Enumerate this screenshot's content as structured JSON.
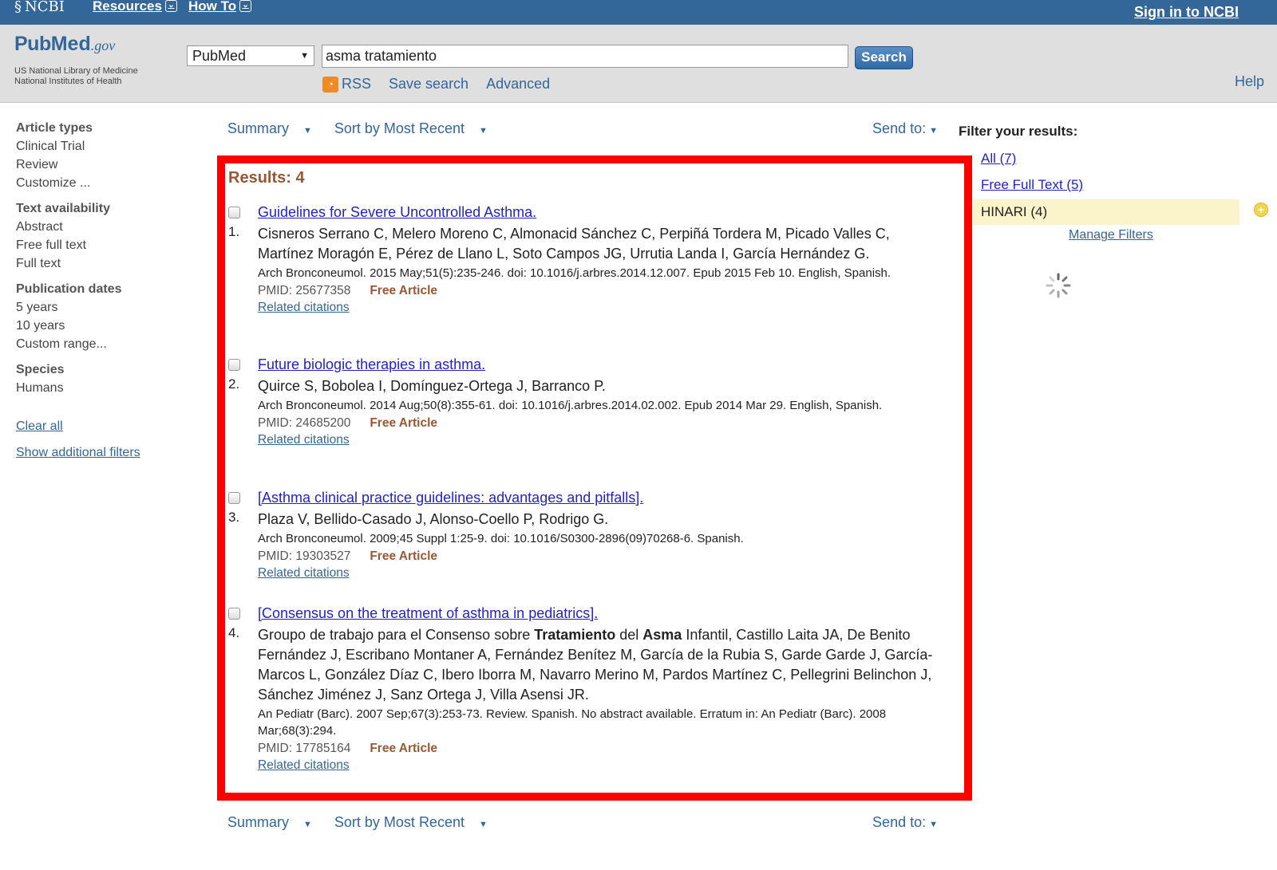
{
  "ncbi": {
    "logo": "NCBI",
    "menu": [
      "Resources",
      "How To"
    ],
    "sign_in": "Sign in to NCBI"
  },
  "header": {
    "logo_pub": "Pub",
    "logo_med": "Med",
    "logo_gov": ".gov",
    "subtitle_1": "US National Library of Medicine",
    "subtitle_2": "National Institutes of Health",
    "database": "PubMed",
    "query": "asma tratamiento",
    "search_label": "Search",
    "rss": "RSS",
    "save_search": "Save search",
    "advanced": "Advanced",
    "help": "Help"
  },
  "sidebar": {
    "groups": [
      {
        "title": "Article types",
        "items": [
          "Clinical Trial",
          "Review",
          "Customize ..."
        ]
      },
      {
        "title": "Text availability",
        "items": [
          "Abstract",
          "Free full text",
          "Full text"
        ]
      },
      {
        "title": "Publication dates",
        "items": [
          "5 years",
          "10 years",
          "Custom range..."
        ]
      },
      {
        "title": "Species",
        "items": [
          "Humans"
        ]
      }
    ],
    "clear_all": "Clear all",
    "show_filters": "Show additional filters"
  },
  "toolbar": {
    "summary": "Summary",
    "sort": "Sort by Most Recent",
    "send_to": "Send to:"
  },
  "results": {
    "count_label": "Results: 4",
    "items": [
      {
        "num": "1.",
        "title": "Guidelines for Severe Uncontrolled Asthma.",
        "authors": "Cisneros Serrano C, Melero Moreno C, Almonacid Sánchez C, Perpiñá Tordera M, Picado Valles C, Martínez Moragón E, Pérez de Llano L, Soto Campos JG, Urrutia Landa I, García Hernández G.",
        "journal": "Arch Bronconeumol. 2015 May;51(5):235-246. doi: 10.1016/j.arbres.2014.12.007. Epub 2015 Feb 10. English, Spanish.",
        "pmid": "PMID: 25677358",
        "free": "Free Article",
        "related": "Related citations"
      },
      {
        "num": "2.",
        "title": "Future biologic therapies in asthma.",
        "authors": "Quirce S, Bobolea I, Domínguez-Ortega J, Barranco P.",
        "journal": "Arch Bronconeumol. 2014 Aug;50(8):355-61. doi: 10.1016/j.arbres.2014.02.002. Epub 2014 Mar 29. English, Spanish.",
        "pmid": "PMID: 24685200",
        "free": "Free Article",
        "related": "Related citations"
      },
      {
        "num": "3.",
        "title": "[Asthma clinical practice guidelines: advantages and pitfalls].",
        "authors": "Plaza V, Bellido-Casado J, Alonso-Coello P, Rodrigo G.",
        "journal": "Arch Bronconeumol. 2009;45 Suppl 1:25-9. doi: 10.1016/S0300-2896(09)70268-6. Spanish.",
        "pmid": "PMID: 19303527",
        "free": "Free Article",
        "related": "Related citations"
      },
      {
        "num": "4.",
        "title": "[Consensus on the treatment of asthma in pediatrics].",
        "authors_pre": "Groupo de trabajo para el Consenso sobre ",
        "authors_b1": "Tratamiento",
        "authors_mid": " del ",
        "authors_b2": "Asma",
        "authors_post": " Infantil, Castillo Laita JA, De Benito Fernández J, Escribano Montaner A, Fernández Benítez M, García de la Rubia S, Garde Garde J, García-Marcos L, González Díaz C, Ibero Iborra M, Navarro Merino M, Pardos Martínez C, Pellegrini Belinchon J, Sánchez Jiménez J, Sanz Ortega J, Villa Asensi JR.",
        "journal": "An Pediatr (Barc). 2007 Sep;67(3):253-73. Review. Spanish. No abstract available. Erratum in: An Pediatr (Barc). 2008 Mar;68(3):294.",
        "pmid": "PMID: 17785164",
        "free": "Free Article",
        "related": "Related citations"
      }
    ]
  },
  "filters": {
    "title": "Filter your results:",
    "all": "All (7)",
    "free_full_text": "Free Full Text (5)",
    "hinari": "HINARI (4)",
    "manage": "Manage Filters"
  },
  "colors": {
    "ncbi_blue": "#336699",
    "header_gray": "#dfdfdf",
    "highlight_red": "#ff0000",
    "result_count": "#985735",
    "link_blue": "#2222cc",
    "hinari_bg": "#fbf3c9"
  },
  "icons": {
    "ncbi": "ncbi-helix-icon",
    "rss": "rss-icon",
    "dropdown": "chevron-down-icon",
    "add_filter": "plus-circle-icon",
    "loading": "spinner-icon"
  }
}
